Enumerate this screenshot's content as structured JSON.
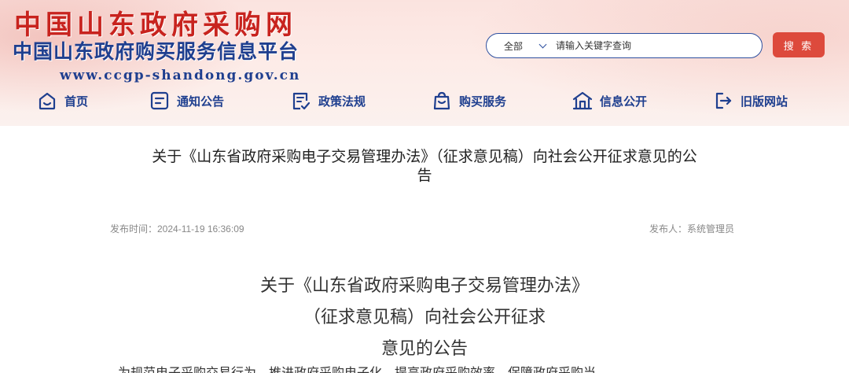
{
  "header": {
    "logo_title": "中国山东政府采购网",
    "logo_subtitle": "中国山东政府购买服务信息平台",
    "logo_url": "www.ccgp-shandong.gov.cn",
    "brand_red": "#c8231e",
    "brand_blue": "#1f3f8f"
  },
  "search": {
    "scope_selected": "全部",
    "placeholder": "请输入关键字查询",
    "button_label": "搜 索",
    "button_color": "#dd4a3c"
  },
  "nav": {
    "items": [
      {
        "label": "首页",
        "icon": "home-icon"
      },
      {
        "label": "通知公告",
        "icon": "notice-icon"
      },
      {
        "label": "政策法规",
        "icon": "policy-icon"
      },
      {
        "label": "购买服务",
        "icon": "shopping-bag-icon"
      },
      {
        "label": "信息公开",
        "icon": "building-icon"
      },
      {
        "label": "旧版网站",
        "icon": "exit-icon"
      }
    ]
  },
  "article": {
    "title_line1": "关于《山东省政府采购电子交易管理办法》（征求意见稿）向社会公开征求意见的公",
    "title_line2": "告",
    "publish_time": "发布时间：2024-11-19 16:36:09",
    "publisher": "发布人：系统管理员",
    "heading_line1": "关于《山东省政府采购电子交易管理办法》",
    "heading_line2": "（征求意见稿）向社会公开征求",
    "heading_line3": "意见的公告",
    "paragraph_partial": "为规范电子采购交易行为，推进政府采购电子化，提高政府采购效率，保障政府采购当"
  }
}
